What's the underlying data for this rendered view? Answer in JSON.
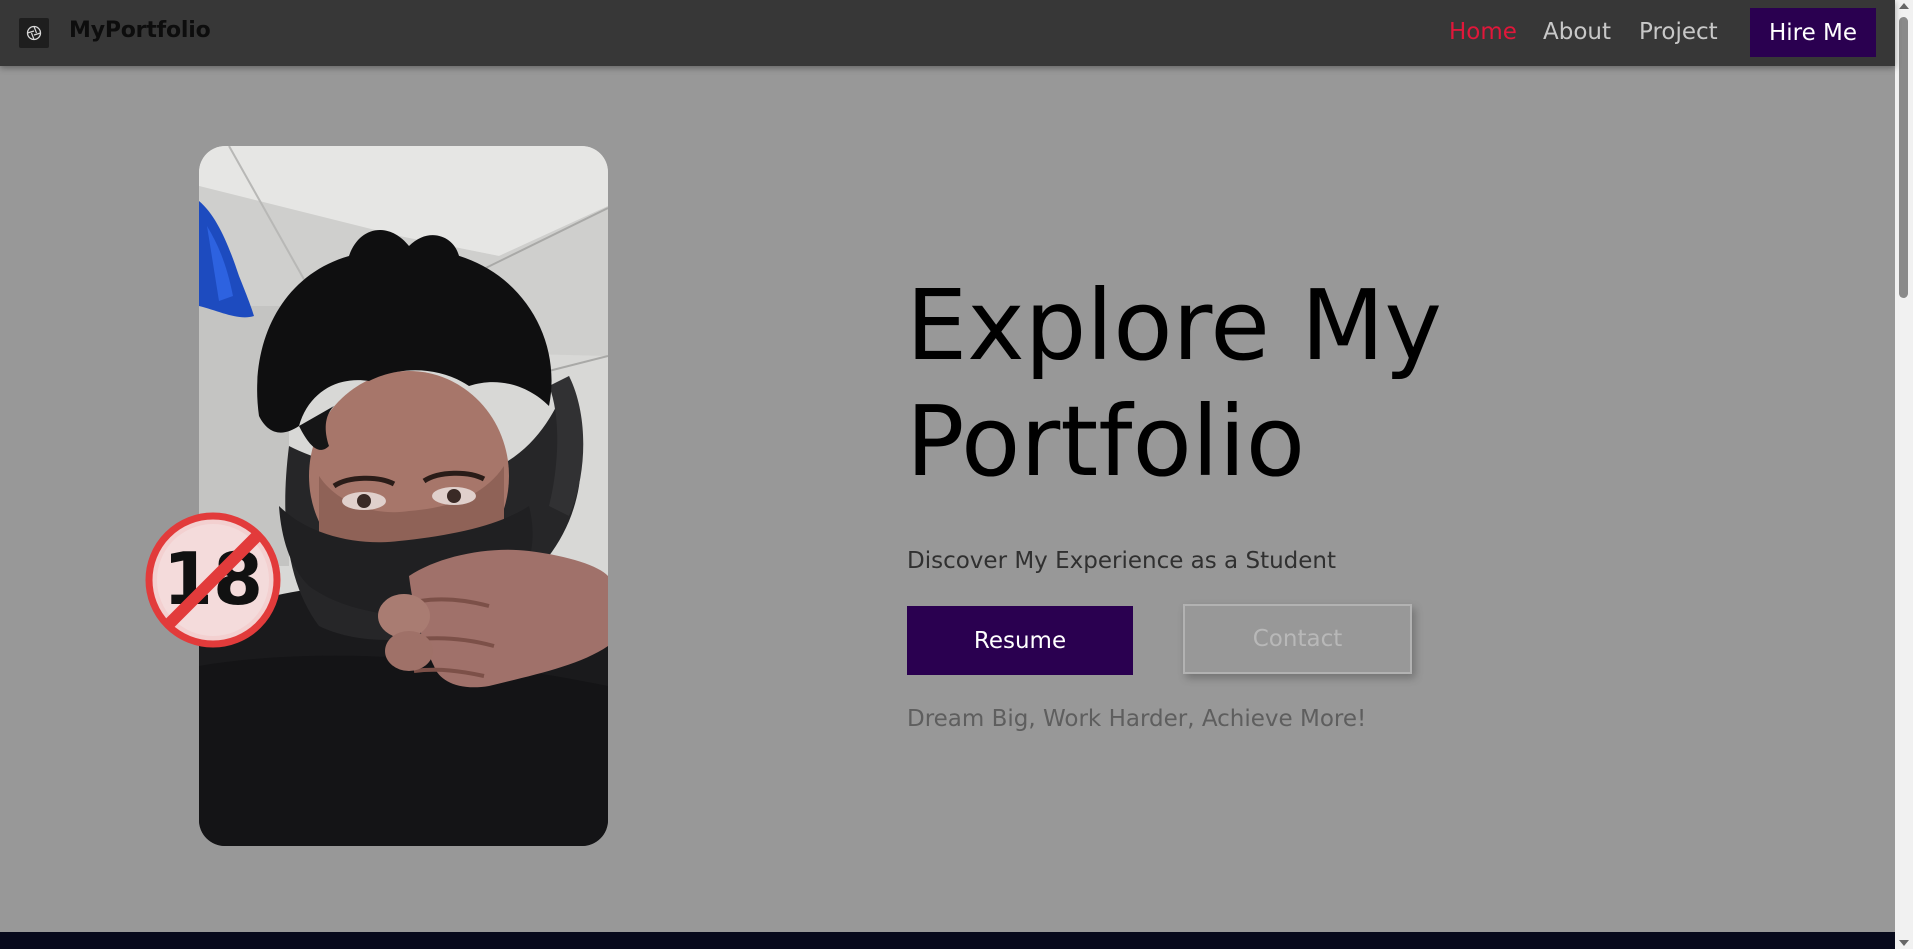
{
  "brand": {
    "name": "MyPortfolio",
    "logo_icon": "aperture-icon"
  },
  "nav": {
    "items": [
      {
        "label": "Home",
        "active": true
      },
      {
        "label": "About",
        "active": false
      },
      {
        "label": "Project",
        "active": false
      }
    ],
    "cta_label": "Hire Me"
  },
  "hero": {
    "title_line1": "Explore My",
    "title_line2": "Portfolio",
    "subtitle": "Discover My Experience as a Student",
    "primary_button": "Resume",
    "secondary_button": "Contact",
    "tagline": "Dream Big, Work Harder, Achieve More!"
  },
  "badge": {
    "text": "18",
    "icon": "no-under-18-icon"
  },
  "colors": {
    "header_bg": "#373737",
    "page_bg": "#989898",
    "accent_purple": "#2a0050",
    "active_nav": "#e0173a",
    "badge_red": "#e23b3b"
  }
}
